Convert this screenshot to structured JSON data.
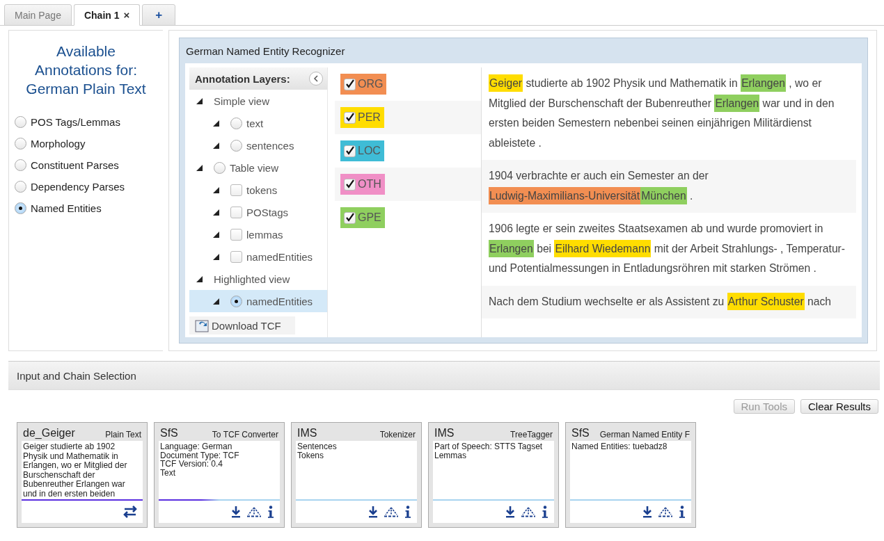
{
  "tabs": [
    {
      "label": "Main Page",
      "selected": false
    },
    {
      "label": "Chain 1",
      "selected": true,
      "close": "×"
    },
    {
      "label": "+",
      "selected": false
    }
  ],
  "sidebar": {
    "title": "Available Annotations for: German Plain Text",
    "options": [
      {
        "label": "POS Tags/Lemmas",
        "selected": false
      },
      {
        "label": "Morphology",
        "selected": false
      },
      {
        "label": "Constituent Parses",
        "selected": false
      },
      {
        "label": "Dependency Parses",
        "selected": false
      },
      {
        "label": "Named Entities",
        "selected": true
      }
    ]
  },
  "viewer": {
    "title": "German Named Entity Recognizer",
    "layers": {
      "title": "Annotation Layers:",
      "tree": [
        {
          "label": "Simple view",
          "kind": "group",
          "children": [
            {
              "label": "text",
              "kind": "radio",
              "selected": false
            },
            {
              "label": "sentences",
              "kind": "radio",
              "selected": false
            }
          ]
        },
        {
          "label": "Table view",
          "kind": "radio",
          "selected": false,
          "children": [
            {
              "label": "tokens",
              "kind": "checkbox",
              "checked": false
            },
            {
              "label": "POStags",
              "kind": "checkbox",
              "checked": false
            },
            {
              "label": "lemmas",
              "kind": "checkbox",
              "checked": false
            },
            {
              "label": "namedEntities",
              "kind": "checkbox",
              "checked": false
            }
          ]
        },
        {
          "label": "Highlighted view",
          "kind": "group",
          "children": [
            {
              "label": "namedEntities",
              "kind": "radio",
              "selected": true
            }
          ]
        }
      ],
      "download": "Download TCF"
    },
    "entities": [
      {
        "label": "ORG",
        "checked": true,
        "color": "#f28e52"
      },
      {
        "label": "PER",
        "checked": true,
        "color": "#ffdd00"
      },
      {
        "label": "LOC",
        "checked": true,
        "color": "#3fbcd6"
      },
      {
        "label": "OTH",
        "checked": true,
        "color": "#f08fc6"
      },
      {
        "label": "GPE",
        "checked": true,
        "color": "#8fcf5f"
      }
    ],
    "paragraphs": [
      [
        {
          "text": "Geiger",
          "color": "#ffdd00"
        },
        {
          "text": " studierte ab 1902 Physik und Mathematik in "
        },
        {
          "text": "Erlangen",
          "color": "#8fcf5f"
        },
        {
          "text": " , wo er Mitglied der Burschenschaft der Bubenreuther "
        },
        {
          "text": "Erlangen",
          "color": "#8fcf5f"
        },
        {
          "text": " war und in den ersten beiden Semestern nebenbei seinen einjährigen Militärdienst ableistete ."
        }
      ],
      [
        {
          "text": "1904 verbrachte er auch ein Semester an der "
        },
        {
          "text": "Ludwig-Maximilians-Universität",
          "color": "#f28e52"
        },
        {
          "text": "München",
          "color": "#8fcf5f"
        },
        {
          "text": " ."
        }
      ],
      [
        {
          "text": "1906 legte er sein zweites Staatsexamen ab und wurde promoviert in "
        },
        {
          "text": "Erlangen",
          "color": "#8fcf5f"
        },
        {
          "text": " bei "
        },
        {
          "text": "Eilhard Wiedemann",
          "color": "#ffdd00"
        },
        {
          "text": " mit der Arbeit Strahlungs- , Temperatur- und Potentialmessungen in Entladungsröhren mit starken Strömen ."
        }
      ],
      [
        {
          "text": "Nach dem Studium wechselte er als Assistent zu "
        },
        {
          "text": "Arthur Schuster",
          "color": "#ffdd00"
        },
        {
          "text": " nach"
        }
      ]
    ]
  },
  "chain": {
    "title": "Input and Chain Selection",
    "buttons": [
      {
        "label": "Run Tools",
        "disabled": true
      },
      {
        "label": "Clear Results",
        "disabled": false
      }
    ],
    "cards": [
      {
        "kind": "input",
        "provider": "de_Geiger",
        "name": "Plain Text",
        "lines": [
          "Geiger studierte ab 1902 Physik und Mathematik in Erlangen, wo er Mitglied der Burschenschaft der Bubenreuther Erlangen war und in den ersten beiden"
        ],
        "processed": true
      },
      {
        "kind": "tool",
        "provider": "SfS",
        "name": "To TCF Converter",
        "lines": [
          "Language: German",
          "Document Type: TCF",
          "TCF Version: 0.4",
          "Text"
        ],
        "processed": false,
        "running": true
      },
      {
        "kind": "tool",
        "provider": "IMS",
        "name": "Tokenizer",
        "lines": [
          "Sentences",
          "Tokens"
        ],
        "processed": false,
        "running": false
      },
      {
        "kind": "tool",
        "provider": "IMS",
        "name": "TreeTagger",
        "lines": [
          "Part of Speech: STTS Tagset",
          "Lemmas"
        ],
        "processed": false,
        "running": false
      },
      {
        "kind": "tool",
        "provider": "SfS",
        "name": "German Named Entity F",
        "lines": [
          "Named Entities: tuebadz8"
        ],
        "processed": false,
        "running": false
      }
    ]
  }
}
